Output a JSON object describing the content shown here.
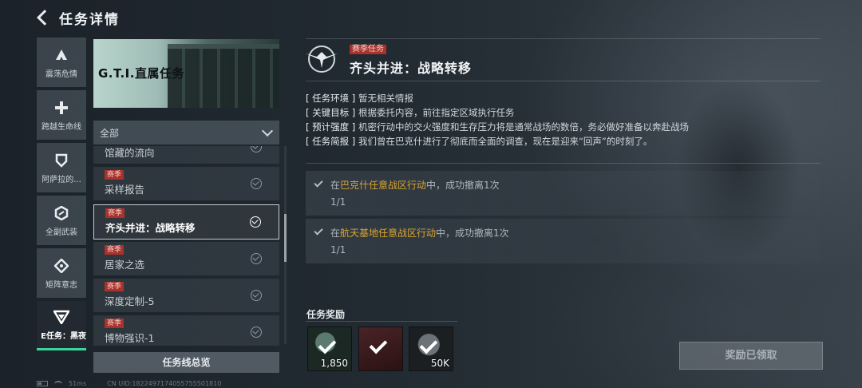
{
  "header": {
    "title": "任务详情"
  },
  "rail": {
    "items": [
      {
        "label": "震荡危情",
        "icon": "delta-icon"
      },
      {
        "label": "跨越生命线",
        "icon": "cross-icon"
      },
      {
        "label": "阿萨拉的...",
        "icon": "shield-icon"
      },
      {
        "label": "全副武装",
        "icon": "hexagon-icon"
      },
      {
        "label": "矩阵意志",
        "icon": "diamond-icon"
      },
      {
        "label": "E任务：黑夜",
        "icon": "triangle-icon"
      }
    ]
  },
  "banner": {
    "title": "G.T.I.直属任务"
  },
  "filter": {
    "selected": "全部"
  },
  "missions": [
    {
      "tag": "",
      "name": "馆藏的流向"
    },
    {
      "tag": "赛季",
      "name": "采样报告"
    },
    {
      "tag": "赛季",
      "name": "齐头并进：战略转移"
    },
    {
      "tag": "赛季",
      "name": "居家之选"
    },
    {
      "tag": "赛季",
      "name": "深度定制-5"
    },
    {
      "tag": "赛季",
      "name": "博物强识-1"
    }
  ],
  "overview_button": "任务线总览",
  "statusbar": {
    "ping": "51ms",
    "uid": "CN UID:1822497174055755501810"
  },
  "detail": {
    "tag": "赛季任务",
    "title": "齐头并进：战略转移",
    "info": [
      {
        "key": "[ 任务环境 ]",
        "value": "暂无相关情报"
      },
      {
        "key": "[ 关键目标 ]",
        "value": "根据委托内容，前往指定区域执行任务"
      },
      {
        "key": "[ 预计强度 ]",
        "value": "机密行动中的交火强度和生存压力将是通常战场的数倍，务必做好准备以奔赴战场"
      },
      {
        "key": "[ 任务简报 ]",
        "value": "我们曾在巴克什进行了彻底而全面的调查，现在是迎来“回声”的时刻了。"
      }
    ],
    "objectives": [
      {
        "pre": "在",
        "place": "巴克什任意战区行动",
        "post": "中，成功撤离1次",
        "progress": "1/1"
      },
      {
        "pre": "在",
        "place": "航天基地任意战区行动",
        "post": "中，成功撤离1次",
        "progress": "1/1"
      }
    ]
  },
  "rewards": {
    "title": "任务奖励",
    "items": [
      {
        "qty": "1,850",
        "icon": "reward-token-icon"
      },
      {
        "qty": "",
        "icon": "reward-item-icon"
      },
      {
        "qty": "50K",
        "icon": "reward-coin-icon"
      }
    ]
  },
  "claim_button": "奖励已领取",
  "colors": {
    "accent": "#3ed39a",
    "season_tag": "#a8322c",
    "highlight": "#d9a431"
  }
}
